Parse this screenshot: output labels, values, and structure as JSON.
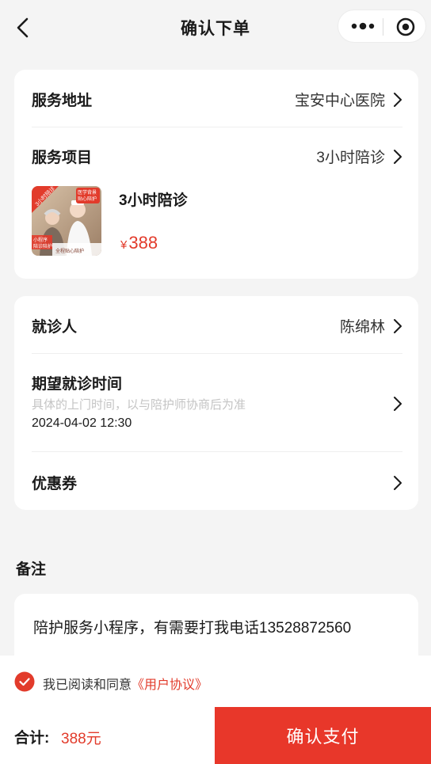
{
  "nav": {
    "title": "确认下单"
  },
  "service": {
    "address_label": "服务地址",
    "address_value": "宝安中心医院",
    "item_label": "服务项目",
    "item_value": "3小时陪诊",
    "product_name": "3小时陪诊",
    "currency": "¥",
    "price": "388",
    "thumb_texts": [
      "3小时陪诊",
      "医学背景",
      "贴心陪护",
      "小程序",
      "陪诊陪护",
      "全程贴心陪护"
    ]
  },
  "patient": {
    "patient_label": "就诊人",
    "patient_value": "陈绵林",
    "time_label": "期望就诊时间",
    "time_hint": "具体的上门时间，以与陪护师协商后为准",
    "time_value": "2024-04-02 12:30",
    "coupon_label": "优惠券"
  },
  "remark": {
    "title": "备注",
    "text": "陪护服务小程序，有需要打我电话13528872560"
  },
  "footer": {
    "agree_text": "我已阅读和同意",
    "agree_link": "《用户协议》",
    "total_label": "合计:",
    "total_amount": "388元",
    "pay_label": "确认支付"
  },
  "colors": {
    "accent": "#e8372a",
    "price": "#e23b2b",
    "background": "#f4f4f4"
  },
  "icons": [
    "back-icon",
    "more-icon",
    "target-icon",
    "chevron-right-icon",
    "check-circle-icon"
  ]
}
